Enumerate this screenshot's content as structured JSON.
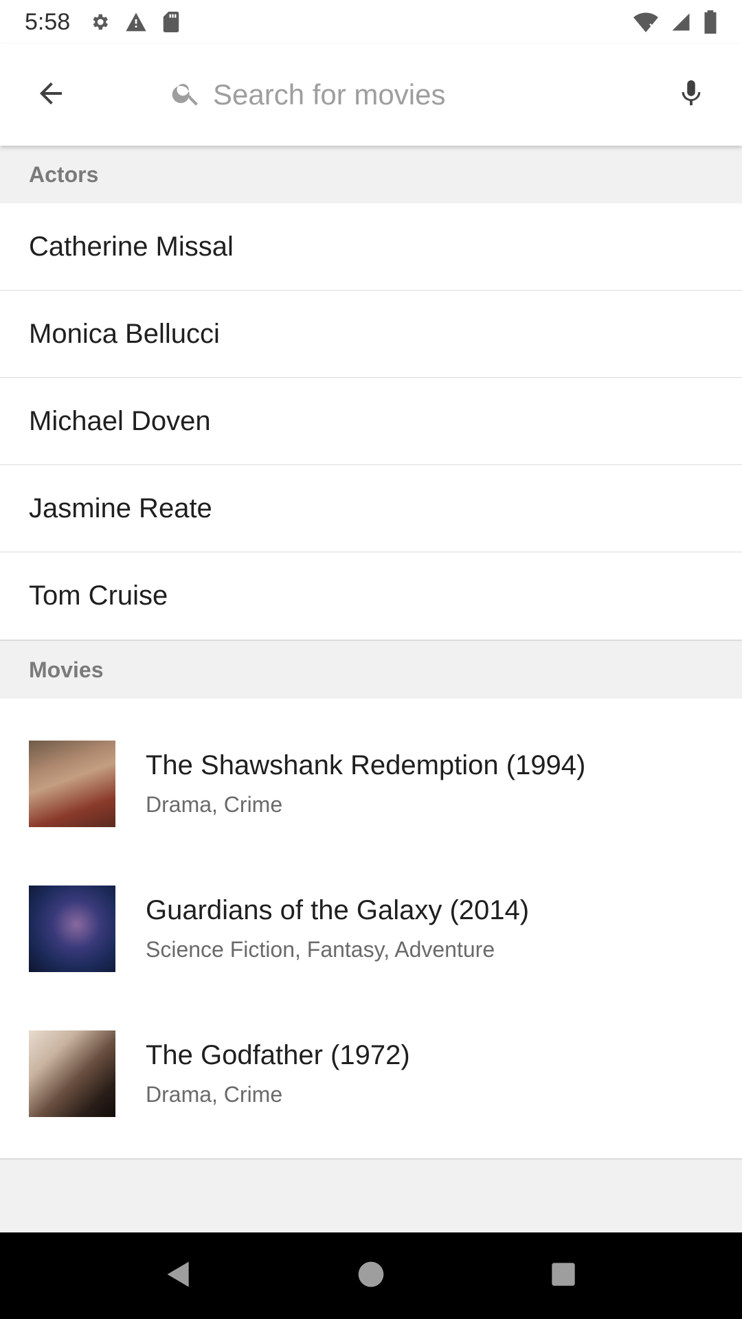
{
  "status_bar": {
    "time": "5:58",
    "icons_left": [
      "settings-icon",
      "warning-icon",
      "sd-card-icon"
    ],
    "icons_right": [
      "wifi-icon",
      "signal-icon",
      "battery-icon"
    ]
  },
  "toolbar": {
    "search_placeholder": "Search for movies",
    "search_value": "",
    "back_icon": "arrow-back-icon",
    "mic_icon": "mic-icon",
    "search_icon": "search-icon"
  },
  "actors_section": {
    "header": "Actors",
    "items": [
      "Catherine Missal",
      "Monica Bellucci",
      "Michael Doven",
      "Jasmine Reate",
      "Tom Cruise"
    ]
  },
  "movies_section": {
    "header": "Movies",
    "items": [
      {
        "title": "The Shawshank Redemption (1994)",
        "genres": "Drama, Crime"
      },
      {
        "title": "Guardians of the Galaxy (2014)",
        "genres": "Science Fiction, Fantasy, Adventure"
      },
      {
        "title": "The Godfather (1972)",
        "genres": "Drama, Crime"
      }
    ]
  },
  "nav_bar": {
    "buttons": [
      "back-triangle-icon",
      "home-circle-icon",
      "recents-square-icon"
    ]
  },
  "colors": {
    "status_icon": "#5a5a5a",
    "toolbar_bg": "#ffffff",
    "section_header_bg": "#f1f1f1",
    "nav_bar_bg": "#000000",
    "nav_icon": "#9e9e9e"
  }
}
